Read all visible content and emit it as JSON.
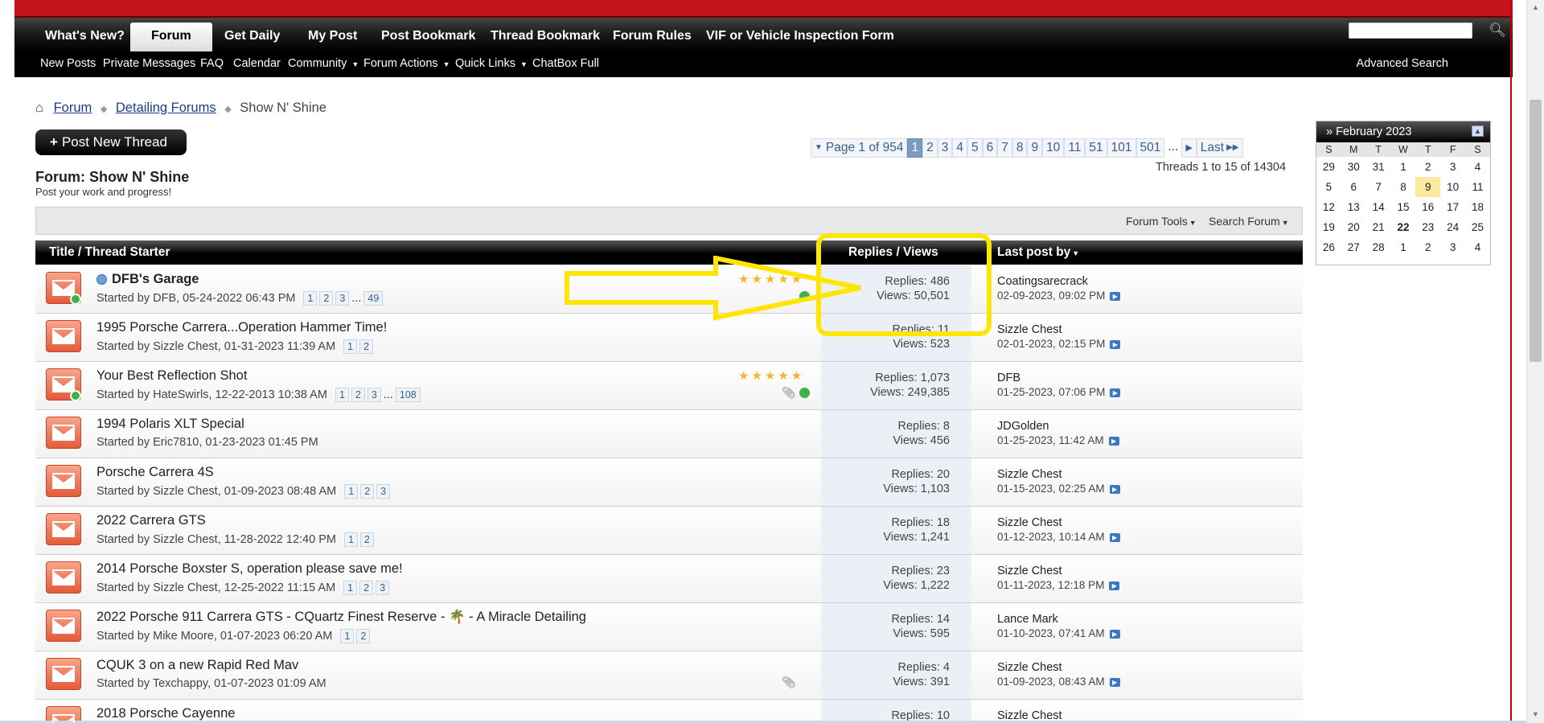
{
  "nav": {
    "tabs": [
      "What's New?",
      "Forum",
      "Get Daily",
      "My Post",
      "Post Bookmark",
      "Thread Bookmark",
      "Forum Rules",
      "VIF or Vehicle Inspection Form"
    ],
    "active_tab": "Forum",
    "search_placeholder": "",
    "sub_items": [
      "New Posts",
      "Private Messages",
      "FAQ",
      "Calendar",
      "Community",
      "Forum Actions",
      "Quick Links",
      "ChatBox Full"
    ],
    "advanced_search": "Advanced Search"
  },
  "breadcrumb": {
    "items": [
      "Forum",
      "Detailing Forums"
    ],
    "current": "Show N' Shine"
  },
  "post_new_thread": "Post New Thread",
  "pager": {
    "label": "Page 1 of 954",
    "pages": [
      "1",
      "2",
      "3",
      "4",
      "5",
      "6",
      "7",
      "8",
      "9",
      "10",
      "11",
      "51",
      "101",
      "501"
    ],
    "current": "1",
    "ellipsis": "...",
    "last": "Last"
  },
  "thread_count": "Threads 1 to 15 of 14304",
  "forum": {
    "title": "Forum: Show N' Shine",
    "description": "Post your work and progress!"
  },
  "tools": {
    "forum_tools": "Forum Tools",
    "search_forum": "Search Forum"
  },
  "columns": {
    "title": "Title / Thread Starter",
    "stats": "Replies / Views",
    "last_post": "Last post by"
  },
  "threads": [
    {
      "title": "DFB's Garage",
      "started": "Started by DFB, 05-24-2022 06:43 PM",
      "pages": [
        "1",
        "2",
        "3",
        "...",
        "49"
      ],
      "replies": "Replies: 486",
      "views": "Views: 50,501",
      "last_user": "Coatingsarecrack",
      "last_date": "02-09-2023, 09:02 PM"
    },
    {
      "title": "1995 Porsche Carrera...Operation Hammer Time!",
      "started": "Started by Sizzle Chest, 01-31-2023 11:39 AM",
      "pages": [
        "1",
        "2"
      ],
      "replies": "Replies: 11",
      "views": "Views: 523",
      "last_user": "Sizzle Chest",
      "last_date": "02-01-2023, 02:15 PM"
    },
    {
      "title": "Your Best Reflection Shot",
      "started": "Started by HateSwirls, 12-22-2013 10:38 AM",
      "pages": [
        "1",
        "2",
        "3",
        "...",
        "108"
      ],
      "replies": "Replies: 1,073",
      "views": "Views: 249,385",
      "last_user": "DFB",
      "last_date": "01-25-2023, 07:06 PM"
    },
    {
      "title": "1994 Polaris XLT Special",
      "started": "Started by Eric7810, 01-23-2023 01:45 PM",
      "pages": [],
      "replies": "Replies: 8",
      "views": "Views: 456",
      "last_user": "JDGolden",
      "last_date": "01-25-2023, 11:42 AM"
    },
    {
      "title": "Porsche Carrera 4S",
      "started": "Started by Sizzle Chest, 01-09-2023 08:48 AM",
      "pages": [
        "1",
        "2",
        "3"
      ],
      "replies": "Replies: 20",
      "views": "Views: 1,103",
      "last_user": "Sizzle Chest",
      "last_date": "01-15-2023, 02:25 AM"
    },
    {
      "title": "2022 Carrera GTS",
      "started": "Started by Sizzle Chest, 11-28-2022 12:40 PM",
      "pages": [
        "1",
        "2"
      ],
      "replies": "Replies: 18",
      "views": "Views: 1,241",
      "last_user": "Sizzle Chest",
      "last_date": "01-12-2023, 10:14 AM"
    },
    {
      "title": "2014 Porsche Boxster S, operation please save me!",
      "started": "Started by Sizzle Chest, 12-25-2022 11:15 AM",
      "pages": [
        "1",
        "2",
        "3"
      ],
      "replies": "Replies: 23",
      "views": "Views: 1,222",
      "last_user": "Sizzle Chest",
      "last_date": "01-11-2023, 12:18 PM"
    },
    {
      "title": "2022 Porsche 911 Carrera GTS - CQuartz Finest Reserve - 🌴 - A Miracle Detailing",
      "started": "Started by Mike Moore, 01-07-2023 06:20 AM",
      "pages": [
        "1",
        "2"
      ],
      "replies": "Replies: 14",
      "views": "Views: 595",
      "last_user": "Lance Mark",
      "last_date": "01-10-2023, 07:41 AM"
    },
    {
      "title": "CQUK 3 on a new Rapid Red Mav",
      "started": "Started by Texchappy, 01-07-2023 01:09 AM",
      "pages": [],
      "replies": "Replies: 4",
      "views": "Views: 391",
      "last_user": "Sizzle Chest",
      "last_date": "01-09-2023, 08:43 AM"
    },
    {
      "title": "2018 Porsche Cayenne",
      "started": "",
      "pages": [],
      "replies": "Replies: 10",
      "views": "",
      "last_user": "Sizzle Chest",
      "last_date": ""
    }
  ],
  "calendar": {
    "title": "» February 2023",
    "days": [
      "S",
      "M",
      "T",
      "W",
      "T",
      "F",
      "S"
    ],
    "weeks": [
      [
        "29",
        "30",
        "31",
        "1",
        "2",
        "3",
        "4"
      ],
      [
        "5",
        "6",
        "7",
        "8",
        "9",
        "10",
        "11"
      ],
      [
        "12",
        "13",
        "14",
        "15",
        "16",
        "17",
        "18"
      ],
      [
        "19",
        "20",
        "21",
        "22",
        "23",
        "24",
        "25"
      ],
      [
        "26",
        "27",
        "28",
        "1",
        "2",
        "3",
        "4"
      ]
    ],
    "today": "9"
  },
  "colors": {
    "brand_red": "#c1141b",
    "annotation_yellow": "#ffe600",
    "page_current": "#7d9bc0"
  }
}
